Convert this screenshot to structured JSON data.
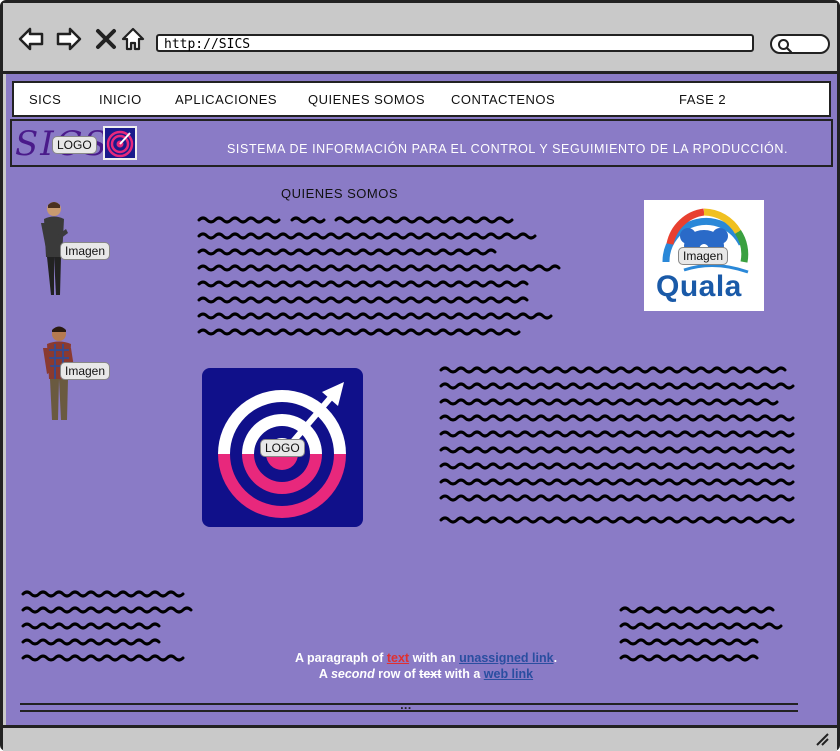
{
  "browser": {
    "url": "http://SICS"
  },
  "menu": {
    "items": [
      "SICS",
      "INICIO",
      "APLICACIONES",
      "QUIENES SOMOS",
      "CONTACTENOS",
      "FASE 2"
    ]
  },
  "header": {
    "logo_text": "SICS",
    "logo_label": "LOGO",
    "title": "SISTEMA DE INFORMACIÓN PARA EL CONTROL Y SEGUIMIENTO DE LA RPODUCCIÓN."
  },
  "main": {
    "section_title": "QUIENES SOMOS",
    "image_label_1": "Imagen",
    "image_label_2": "Imagen",
    "image_label_3": "Imagen",
    "big_logo_label": "LOGO",
    "quala_word": "Quala"
  },
  "paragraph": {
    "line1_a": "A paragraph of ",
    "line1_text_link": "text",
    "line1_b": " with an ",
    "line1_unassigned_link": "unassigned link",
    "line1_c": ".",
    "line2_a": "A ",
    "line2_second": "second",
    "line2_b": " row of ",
    "line2_text": "text",
    "line2_c": " with a ",
    "line2_web_link": "web link"
  },
  "footer": {
    "dots": "..."
  },
  "colors": {
    "page_bg": "#8a7bc6",
    "logo_bg": "#10108a",
    "logo_pink": "#e8287c"
  }
}
